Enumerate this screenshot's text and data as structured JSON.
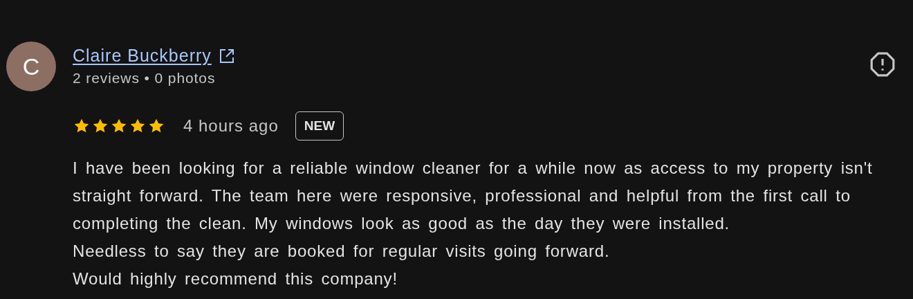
{
  "review": {
    "avatar_letter": "C",
    "author": "Claire Buckberry",
    "author_meta": "2 reviews • 0 photos",
    "stars": 5,
    "time": "4 hours ago",
    "badge": "NEW",
    "text": [
      "I have been looking for a reliable window cleaner for a while now as access to my property isn't straight forward. The team here were responsive, professional and helpful from the first call to completing the clean. My windows look as good as the day they were installed.",
      "Needless to say they are booked for regular visits going forward.",
      "Would highly recommend this company!"
    ]
  }
}
